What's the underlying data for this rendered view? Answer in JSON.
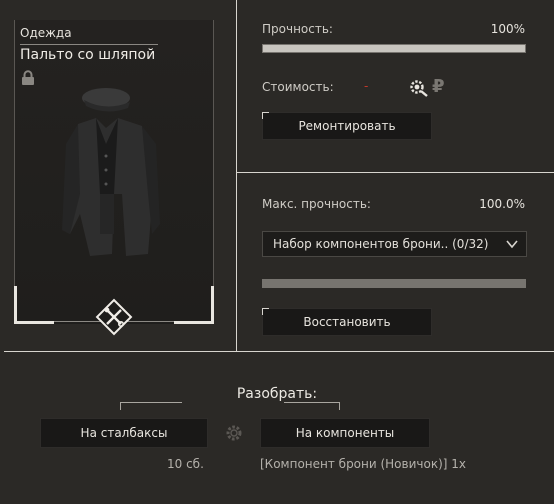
{
  "card": {
    "category": "Одежда",
    "name": "Пальто со шляпой"
  },
  "durability": {
    "label": "Прочность:",
    "value": "100%",
    "fill": 1.0
  },
  "cost": {
    "label": "Стоимость:",
    "value": "-",
    "currency": "₽"
  },
  "repair_button": "Ремонтировать",
  "max_durability": {
    "label": "Макс. прочность:",
    "value": "100.0%",
    "fill": 1.0
  },
  "kit_select": {
    "selected": "Набор компонентов брони.. (0/32)"
  },
  "restore_button": "Восстановить",
  "disassemble": {
    "title": "Разобрать:",
    "stalbucks_button": "На сталбаксы",
    "components_button": "На компоненты",
    "stalbucks_amount": "10 сб.",
    "components_result": "[Компонент брони (Новичок)] 1x"
  },
  "icons": [
    "lock-icon",
    "repair-tools-icon",
    "settings-gear-icon",
    "ruble-icon",
    "chevron-down-icon",
    "gear-icon"
  ],
  "colors": {
    "background": "#2b2926",
    "accent_red": "#c0392b"
  }
}
